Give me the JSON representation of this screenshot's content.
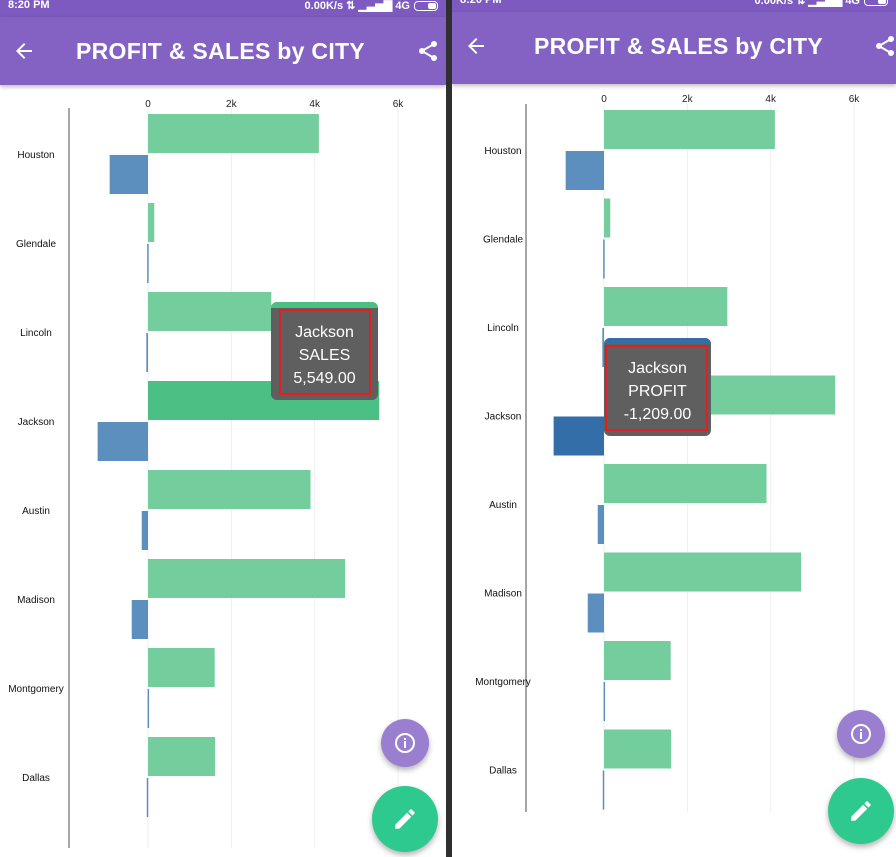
{
  "status_bar": {
    "time": "8:20 PM",
    "network": "0.00K/s",
    "signal_type": "4G"
  },
  "app_bar": {
    "title": "PROFIT & SALES by CITY",
    "back_icon": "arrow-back-icon",
    "share_icon": "share-icon"
  },
  "colors": {
    "app_bar": "#8462c4",
    "status_bar": "#7d5abf",
    "sales": "#74cd9d",
    "sales_highlight": "#4cc084",
    "profit": "#5c8fbd",
    "profit_highlight": "#336ea8",
    "fab_info": "#9a7fd1",
    "fab_edit": "#2ec98e",
    "tooltip_bg": "#5f5f5f",
    "tooltip_border": "#e02020"
  },
  "chart_data": [
    {
      "type": "bar",
      "orientation": "horizontal",
      "categories": [
        "Houston",
        "Glendale",
        "Lincoln",
        "Jackson",
        "Austin",
        "Madison",
        "Montgomery",
        "Dallas"
      ],
      "x_ticks": [
        "0",
        "2k",
        "4k",
        "6k"
      ],
      "xlim": [
        -1300,
        6000
      ],
      "grid": true,
      "series": [
        {
          "key": "sales",
          "values": [
            4100,
            150,
            2960,
            5549,
            3900,
            4730,
            1600,
            1610
          ]
        },
        {
          "key": "profit",
          "values": [
            -920,
            -20,
            -40,
            -1209,
            -150,
            -390,
            -10,
            -30
          ]
        }
      ],
      "highlight": {
        "category": "Jackson",
        "series": "sales"
      },
      "tooltip": {
        "city": "Jackson",
        "measure": "SALES",
        "value": "5,549.00"
      }
    },
    {
      "type": "bar",
      "orientation": "horizontal",
      "categories": [
        "Houston",
        "Glendale",
        "Lincoln",
        "Jackson",
        "Austin",
        "Madison",
        "Montgomery",
        "Dallas"
      ],
      "x_ticks": [
        "0",
        "2k",
        "4k",
        "6k"
      ],
      "xlim": [
        -1300,
        6000
      ],
      "grid": true,
      "series": [
        {
          "key": "sales",
          "values": [
            4100,
            150,
            2960,
            5549,
            3900,
            4730,
            1600,
            1610
          ]
        },
        {
          "key": "profit",
          "values": [
            -920,
            -20,
            -40,
            -1209,
            -150,
            -390,
            -10,
            -30
          ]
        }
      ],
      "highlight": {
        "category": "Jackson",
        "series": "profit"
      },
      "tooltip": {
        "city": "Jackson",
        "measure": "PROFIT",
        "value": "-1,209.00"
      }
    }
  ],
  "fab": {
    "info_icon": "info-icon",
    "edit_icon": "pencil-icon"
  }
}
